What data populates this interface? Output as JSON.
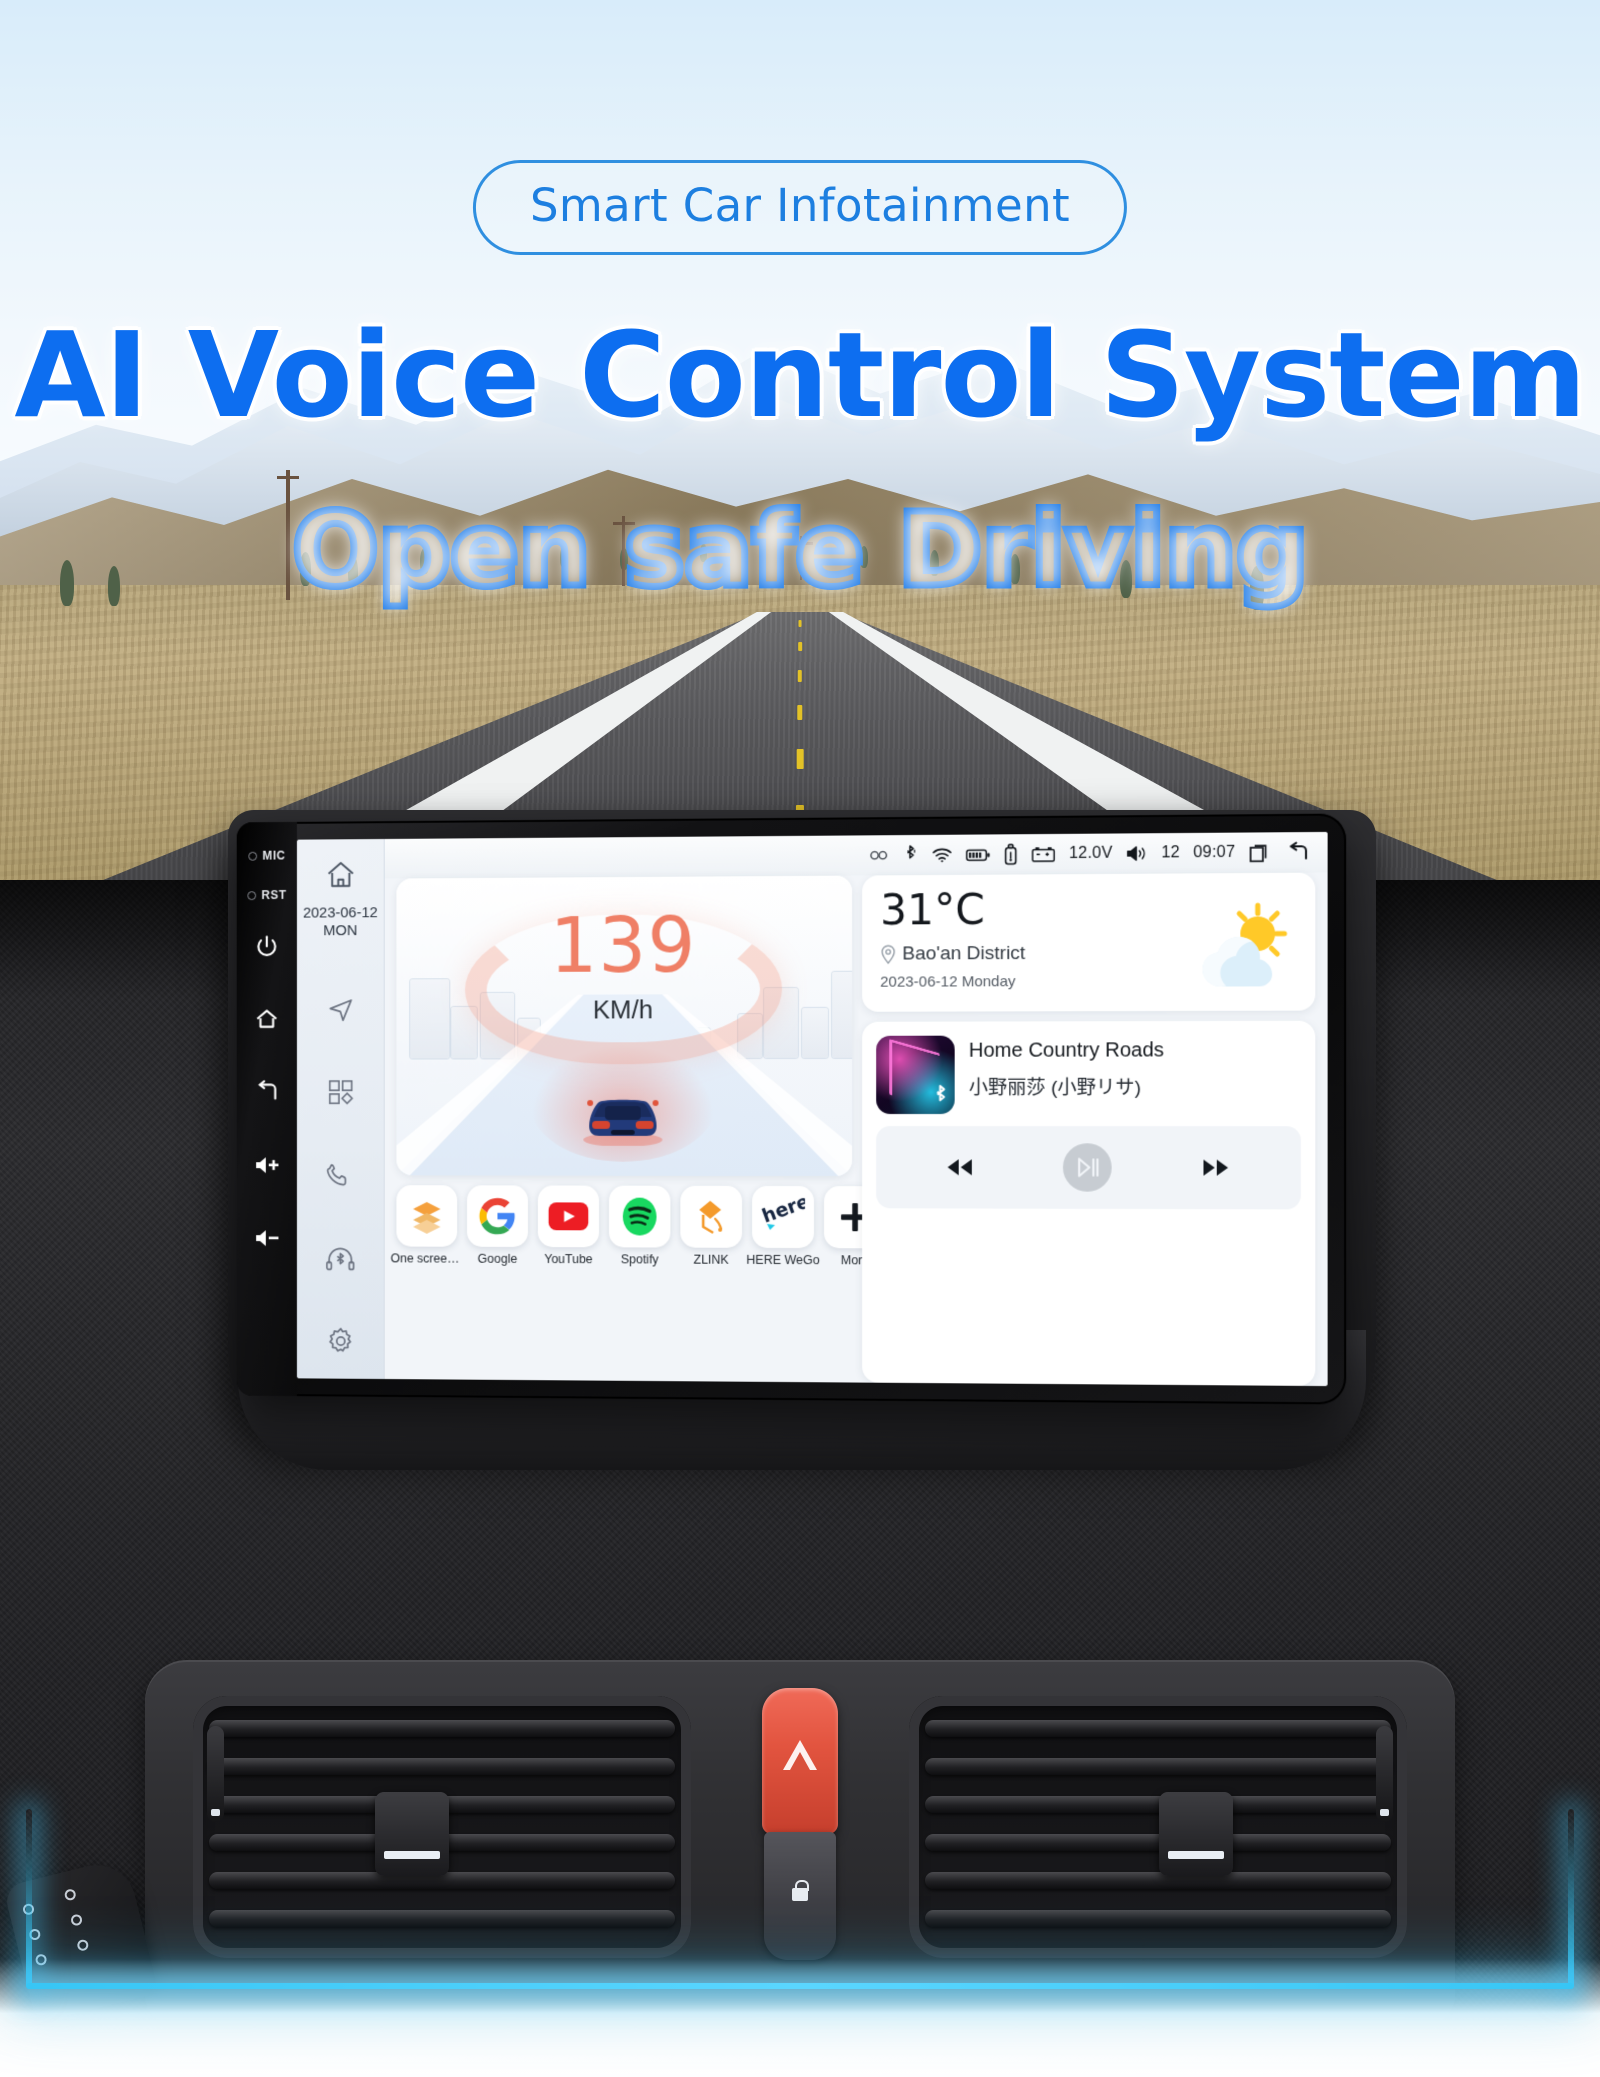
{
  "banner": {
    "pill_label": "Smart Car Infotainment",
    "headline": "AI Voice Control System",
    "subheadline": "Open safe Driving",
    "accent_blue": "#0d6ef0",
    "pill_blue": "#1d7fe0",
    "glow_cyan": "#37c6f5"
  },
  "bezel": {
    "leds": [
      {
        "name": "mic-led",
        "label": "MIC"
      },
      {
        "name": "reset-led",
        "label": "RST"
      }
    ],
    "buttons": [
      {
        "name": "power-button",
        "icon": "power-icon"
      },
      {
        "name": "home-button",
        "icon": "home-icon"
      },
      {
        "name": "back-button",
        "icon": "back-arrow-icon"
      },
      {
        "name": "volume-up-button",
        "icon": "volume-up-icon"
      },
      {
        "name": "volume-down-button",
        "icon": "volume-down-icon"
      }
    ]
  },
  "sidebar": {
    "home_icon": "home-outline-icon",
    "date": "2023-06-12",
    "weekday": "MON",
    "items": [
      {
        "name": "navigation",
        "icon": "navigation-arrow-icon"
      },
      {
        "name": "all-apps",
        "icon": "apps-grid-icon"
      },
      {
        "name": "phone",
        "icon": "phone-icon"
      },
      {
        "name": "bluetooth-audio",
        "icon": "bluetooth-headset-icon"
      },
      {
        "name": "settings",
        "icon": "gear-icon"
      }
    ]
  },
  "statusbar": {
    "icons": [
      "link-icon",
      "bluetooth-icon",
      "wifi-icon",
      "battery-icon",
      "usb-icon",
      "car-battery-icon"
    ],
    "voltage": "12.0V",
    "volume_icon": "volume-icon",
    "volume_level": "12",
    "time": "09:07",
    "recents_icon": "recents-icon",
    "back_icon": "back-arrow-icon"
  },
  "hud": {
    "speed": "139",
    "unit": "KM/h",
    "speed_color": "#ef7f66"
  },
  "weather": {
    "temperature": "31°C",
    "location": "Bao'an District",
    "date": "2023-06-12 Monday",
    "condition_icon": "sun-behind-cloud-icon"
  },
  "music": {
    "title": "Home Country Roads",
    "artist": "小野丽莎 (小野リサ)",
    "source_icon": "bluetooth-icon",
    "prev_icon": "previous-track-icon",
    "play_icon": "play-pause-icon",
    "next_icon": "next-track-icon"
  },
  "dock": {
    "apps": [
      {
        "label": "One screen in...",
        "icon": "stacked-layers-icon"
      },
      {
        "label": "Google",
        "icon": "google-icon"
      },
      {
        "label": "YouTube",
        "icon": "youtube-icon"
      },
      {
        "label": "Spotify",
        "icon": "spotify-icon"
      },
      {
        "label": "ZLINK",
        "icon": "zlink-icon"
      },
      {
        "label": "HERE WeGo",
        "icon": "here-wego-icon"
      },
      {
        "label": "More",
        "icon": "plus-icon"
      }
    ]
  }
}
